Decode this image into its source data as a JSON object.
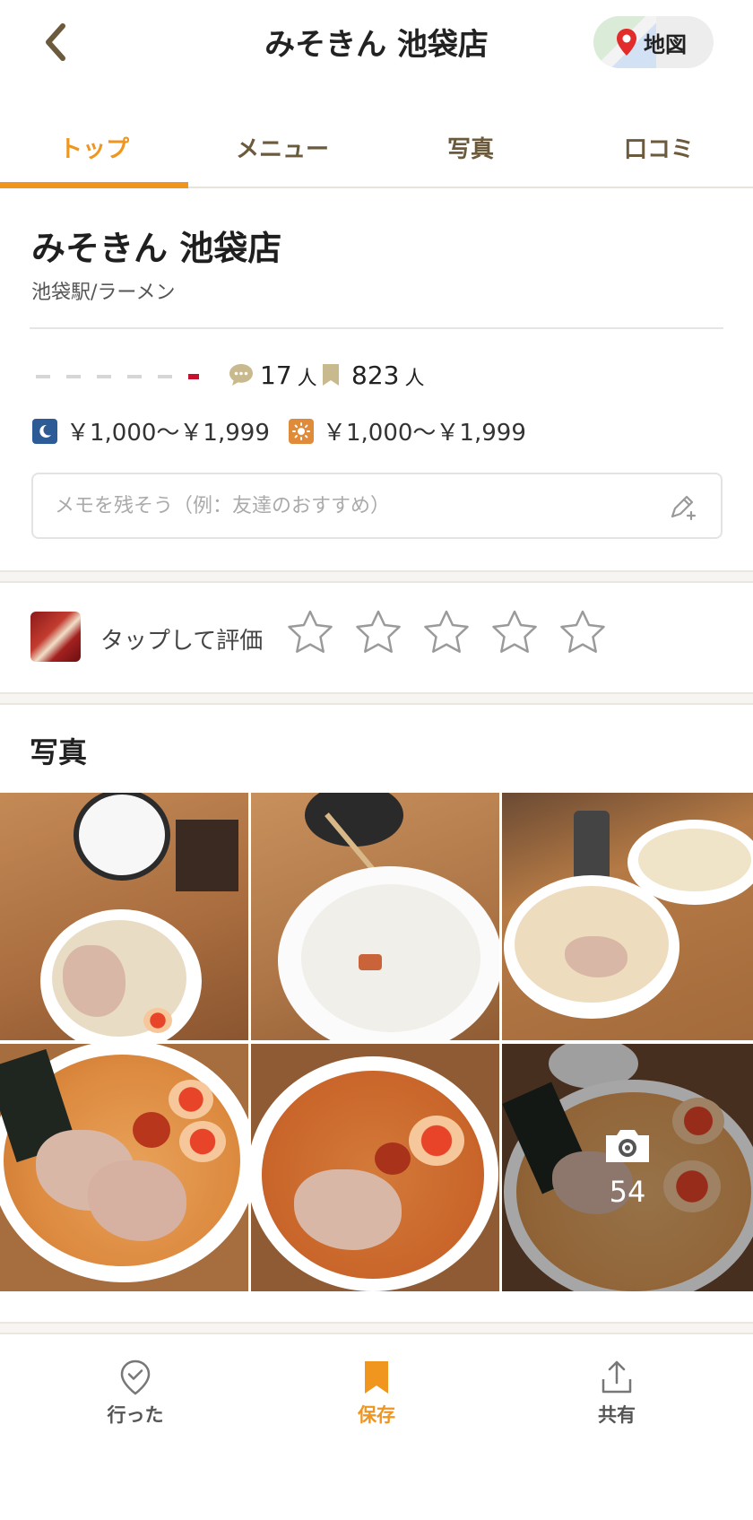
{
  "header": {
    "title": "みそきん 池袋店",
    "map_label": "地図"
  },
  "tabs": [
    {
      "label": "トップ",
      "active": true
    },
    {
      "label": "メニュー",
      "active": false
    },
    {
      "label": "写真",
      "active": false
    },
    {
      "label": "口コミ",
      "active": false
    }
  ],
  "shop": {
    "name": "みそきん 池袋店",
    "subtitle": "池袋駅/ラーメン",
    "reviews_count": "17",
    "reviews_unit": "人",
    "saved_count": "823",
    "saved_unit": "人",
    "dinner_price": "￥1,000～￥1,999",
    "lunch_price": "￥1,000～￥1,999"
  },
  "memo": {
    "placeholder": "メモを残そう（例：友達のおすすめ）"
  },
  "rating": {
    "label": "タップして評価",
    "stars": 5
  },
  "photos": {
    "title": "写真",
    "more_count": "54"
  },
  "bottom_nav": [
    {
      "label": "行った",
      "icon": "check-pin-icon",
      "active": false
    },
    {
      "label": "保存",
      "icon": "bookmark-icon",
      "active": true
    },
    {
      "label": "共有",
      "icon": "share-icon",
      "active": false
    }
  ],
  "colors": {
    "accent": "#f0951d",
    "tab_inactive": "#6b5a3c",
    "rating_red": "#c8102e"
  }
}
